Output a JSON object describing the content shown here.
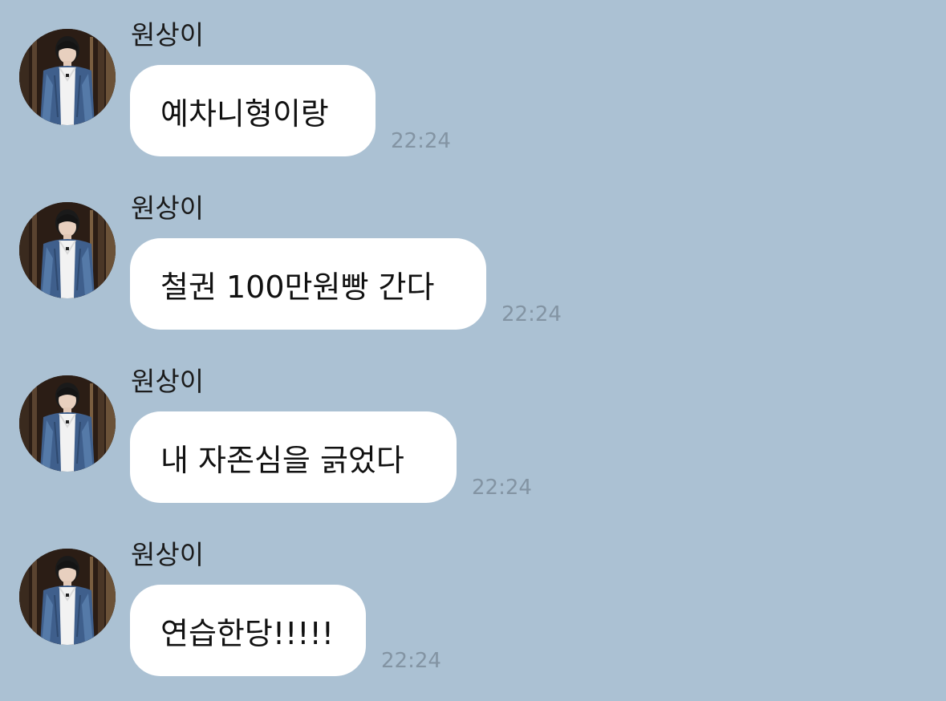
{
  "chat": {
    "background": "#abc1d3",
    "messages": [
      {
        "sender": "원상이",
        "text": "예차니형이랑",
        "time": "22:24",
        "avatar_icon": "profile-photo"
      },
      {
        "sender": "원상이",
        "text": "철권 100만원빵 간다",
        "time": "22:24",
        "avatar_icon": "profile-photo"
      },
      {
        "sender": "원상이",
        "text": "내 자존심을 긁었다",
        "time": "22:24",
        "avatar_icon": "profile-photo"
      },
      {
        "sender": "원상이",
        "text": "연습한당!!!!!",
        "time": "22:24",
        "avatar_icon": "profile-photo"
      }
    ]
  }
}
